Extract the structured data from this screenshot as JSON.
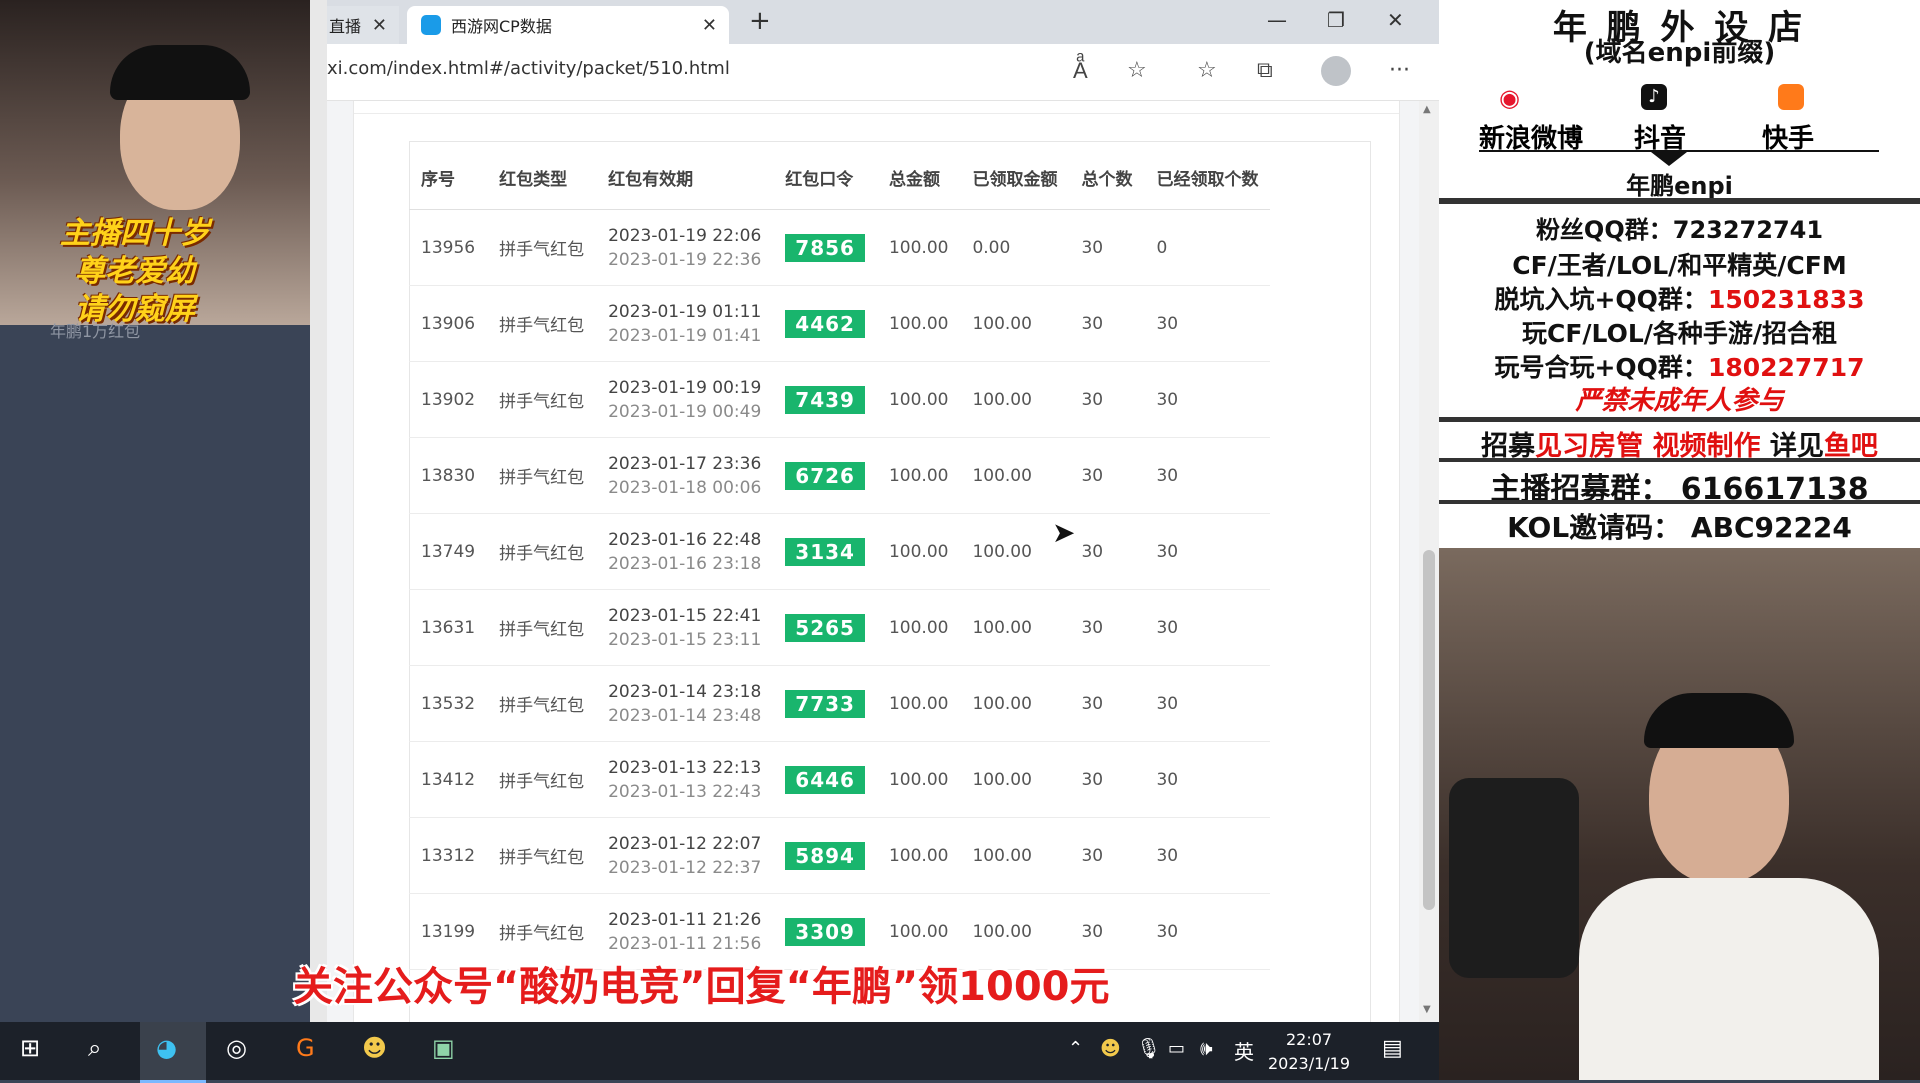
{
  "browser": {
    "prev_tab": "直播",
    "active_tab": "西游网CP数据",
    "url": "xi.com/index.html#/activity/packet/510.html"
  },
  "table": {
    "headers": [
      "序号",
      "红包类型",
      "红包有效期",
      "红包口令",
      "总金额",
      "已领取金额",
      "总个数",
      "已经领取个数"
    ],
    "rows": [
      {
        "id": "13956",
        "type": "拼手气红包",
        "start": "2023-01-19 22:06",
        "end": "2023-01-19 22:36",
        "code": "7856",
        "total": "100.00",
        "claimed": "0.00",
        "count": "30",
        "claimed_count": "0"
      },
      {
        "id": "13906",
        "type": "拼手气红包",
        "start": "2023-01-19 01:11",
        "end": "2023-01-19 01:41",
        "code": "4462",
        "total": "100.00",
        "claimed": "100.00",
        "count": "30",
        "claimed_count": "30"
      },
      {
        "id": "13902",
        "type": "拼手气红包",
        "start": "2023-01-19 00:19",
        "end": "2023-01-19 00:49",
        "code": "7439",
        "total": "100.00",
        "claimed": "100.00",
        "count": "30",
        "claimed_count": "30"
      },
      {
        "id": "13830",
        "type": "拼手气红包",
        "start": "2023-01-17 23:36",
        "end": "2023-01-18 00:06",
        "code": "6726",
        "total": "100.00",
        "claimed": "100.00",
        "count": "30",
        "claimed_count": "30"
      },
      {
        "id": "13749",
        "type": "拼手气红包",
        "start": "2023-01-16 22:48",
        "end": "2023-01-16 23:18",
        "code": "3134",
        "total": "100.00",
        "claimed": "100.00",
        "count": "30",
        "claimed_count": "30"
      },
      {
        "id": "13631",
        "type": "拼手气红包",
        "start": "2023-01-15 22:41",
        "end": "2023-01-15 23:11",
        "code": "5265",
        "total": "100.00",
        "claimed": "100.00",
        "count": "30",
        "claimed_count": "30"
      },
      {
        "id": "13532",
        "type": "拼手气红包",
        "start": "2023-01-14 23:18",
        "end": "2023-01-14 23:48",
        "code": "7733",
        "total": "100.00",
        "claimed": "100.00",
        "count": "30",
        "claimed_count": "30"
      },
      {
        "id": "13412",
        "type": "拼手气红包",
        "start": "2023-01-13 22:13",
        "end": "2023-01-13 22:43",
        "code": "6446",
        "total": "100.00",
        "claimed": "100.00",
        "count": "30",
        "claimed_count": "30"
      },
      {
        "id": "13312",
        "type": "拼手气红包",
        "start": "2023-01-12 22:07",
        "end": "2023-01-12 22:37",
        "code": "5894",
        "total": "100.00",
        "claimed": "100.00",
        "count": "30",
        "claimed_count": "30"
      },
      {
        "id": "13199",
        "type": "拼手气红包",
        "start": "2023-01-11 21:26",
        "end": "2023-01-11 21:56",
        "code": "3309",
        "total": "100.00",
        "claimed": "100.00",
        "count": "30",
        "claimed_count": "30"
      }
    ]
  },
  "overlay_left": {
    "caption1": "主播四十岁",
    "caption2": "尊老爱幼",
    "caption3": "请勿窥屏",
    "faded": "年鹏1万红包"
  },
  "overlay_right": {
    "shop_title": "年 鹏 外 设 店",
    "shop_sub": "(域名enpi前缀)",
    "weibo": "新浪微博",
    "douyin": "抖音",
    "kuaishou": "快手",
    "handle": "年鹏enpi",
    "qq_group_label": "粉丝QQ群：",
    "qq_group": "723272741",
    "games": "CF/王者/LOL/和平精英/CFM",
    "pit_label": "脱坑入坑+QQ群：",
    "pit_qq": "150231833",
    "rent": "玩CF/LOL/各种手游/招合租",
    "account_label": "玩号合玩+QQ群：",
    "account_qq": "180227717",
    "minors": "严禁未成年人参与",
    "recruit_a": "招募",
    "recruit_b": "见习房管 视频制作",
    "recruit_c": " 详见",
    "recruit_d": "鱼吧",
    "anchor_group": "主播招募群：  616617138",
    "kol": "KOL邀请码：  ABC92224"
  },
  "subtitle": "关注公众号“酸奶电竞”回复“年鹏”领1000元",
  "taskbar": {
    "time": "22:07",
    "date": "2023/1/19",
    "ime": "英"
  },
  "colors": {
    "code_green": "#19b56d",
    "accent_red": "#e01010",
    "subtitle_red": "#e51c1c"
  }
}
